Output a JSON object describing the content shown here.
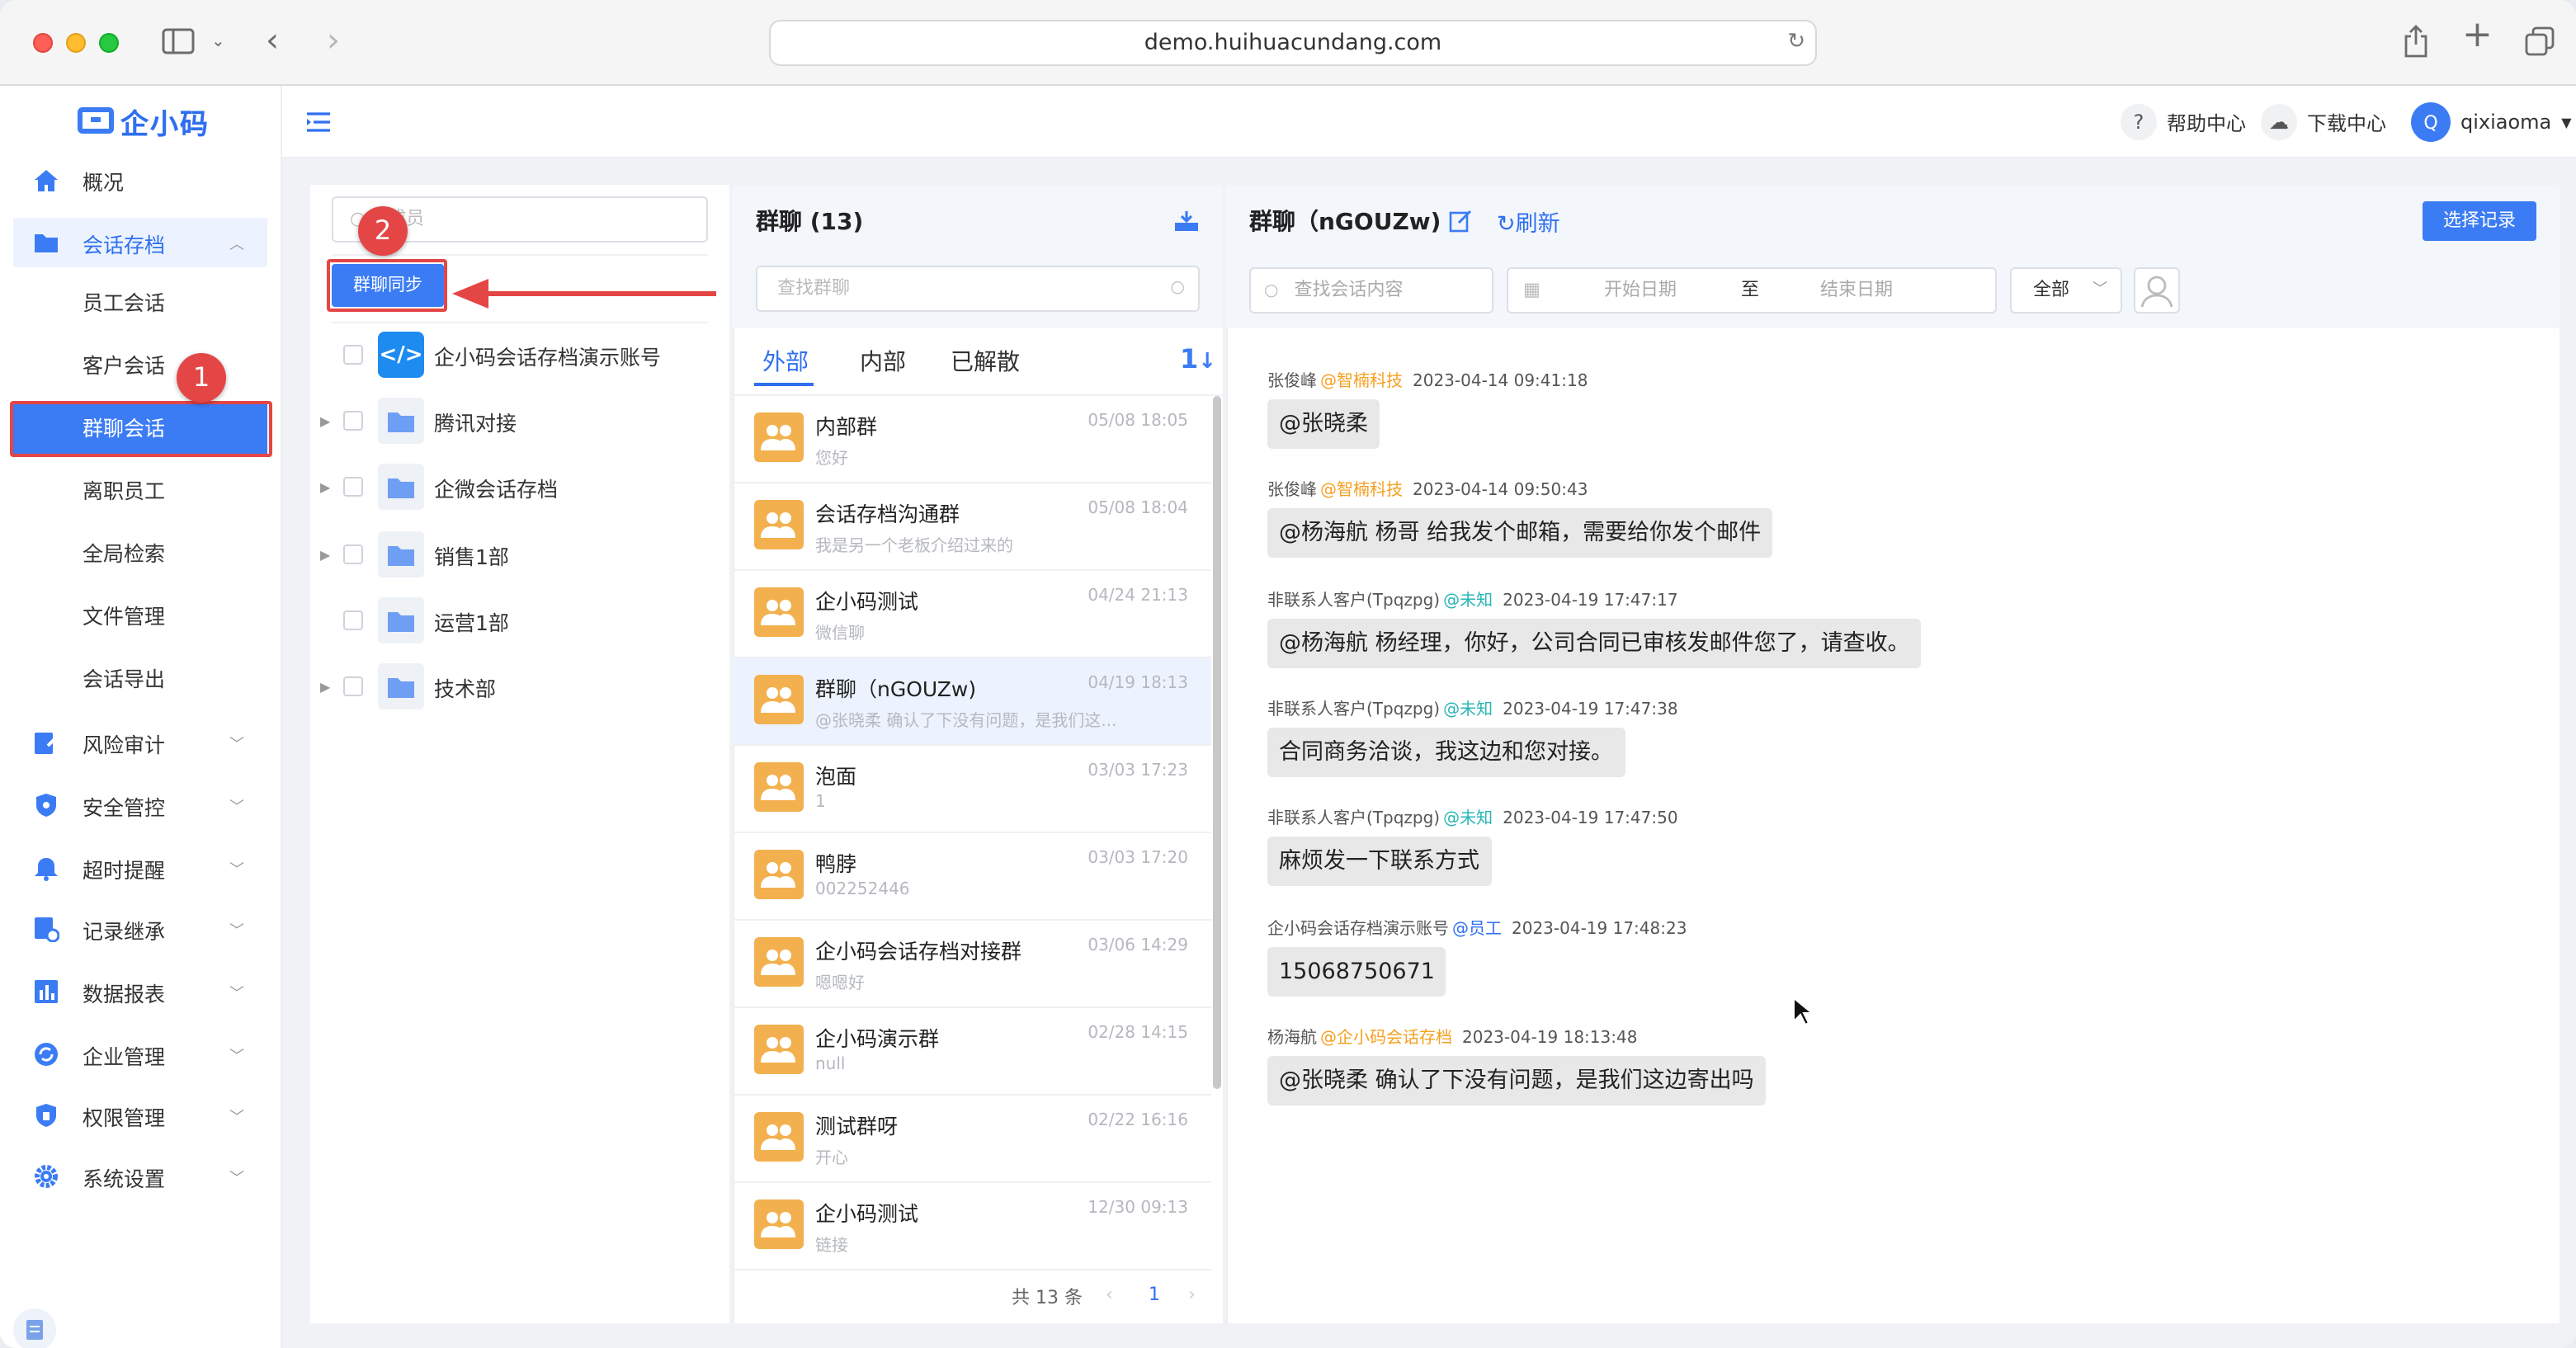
{
  "browser": {
    "url": "demo.huihuacundang.com"
  },
  "brand": {
    "logo_text": "企小码",
    "accent": "#3b7cf5"
  },
  "sidebar": {
    "items": [
      {
        "label": "概况"
      },
      {
        "label": "会话存档"
      },
      {
        "label": "风险审计"
      },
      {
        "label": "安全管控"
      },
      {
        "label": "超时提醒"
      },
      {
        "label": "记录继承"
      },
      {
        "label": "数据报表"
      },
      {
        "label": "企业管理"
      },
      {
        "label": "权限管理"
      },
      {
        "label": "系统设置"
      }
    ],
    "sub_items": [
      {
        "label": "员工会话"
      },
      {
        "label": "客户会话"
      },
      {
        "label": "群聊会话"
      },
      {
        "label": "离职员工"
      },
      {
        "label": "全局检索"
      },
      {
        "label": "文件管理"
      },
      {
        "label": "会话导出"
      }
    ]
  },
  "topbar": {
    "help": "帮助中心",
    "download": "下载中心",
    "avatar_letter": "Q",
    "username": "qixiaoma"
  },
  "annotations": {
    "step1": "1",
    "step2": "2"
  },
  "members": {
    "search_placeholder": "成员",
    "sync_button": "群聊同步",
    "tree": [
      {
        "label": "企小码会话存档演示账号"
      },
      {
        "label": "腾讯对接"
      },
      {
        "label": "企微会话存档"
      },
      {
        "label": "销售1部"
      },
      {
        "label": "运营1部"
      },
      {
        "label": "技术部"
      }
    ]
  },
  "groups": {
    "title": "群聊 (13)",
    "search_placeholder": "查找群聊",
    "tabs": [
      "外部",
      "内部",
      "已解散"
    ],
    "list": [
      {
        "name": "内部群",
        "preview": "您好",
        "time": "05/08 18:05"
      },
      {
        "name": "会话存档沟通群",
        "preview": "我是另一个老板介绍过来的",
        "time": "05/08 18:04"
      },
      {
        "name": "企小码测试",
        "preview": "微信聊",
        "time": "04/24 21:13"
      },
      {
        "name": "群聊（nGOUZw)",
        "preview": "@张晓柔 确认了下没有问题，是我们这...",
        "time": "04/19 18:13"
      },
      {
        "name": "泡面",
        "preview": "1",
        "time": "03/03 17:23"
      },
      {
        "name": "鸭脖",
        "preview": "002252446",
        "time": "03/03 17:20"
      },
      {
        "name": "企小码会话存档对接群",
        "preview": "嗯嗯好",
        "time": "03/06 14:29"
      },
      {
        "name": "企小码演示群",
        "preview": "null",
        "time": "02/28 14:15"
      },
      {
        "name": "测试群呀",
        "preview": "开心",
        "time": "02/22 16:16"
      },
      {
        "name": "企小码测试",
        "preview": "链接",
        "time": "12/30 09:13"
      }
    ],
    "pager": {
      "total": "共 13 条",
      "page": "1"
    }
  },
  "chat": {
    "title": "群聊（nGOUZw)",
    "refresh": "刷新",
    "select_button": "选择记录",
    "search_placeholder": "查找会话内容",
    "start_date": "开始日期",
    "to": "至",
    "end_date": "结束日期",
    "filter": "全部",
    "messages": [
      {
        "sender": "张俊峰",
        "tag": "@智楠科技",
        "tag_color": "#f5a020",
        "time": "2023-04-14 09:41:18",
        "text": "@张晓柔"
      },
      {
        "sender": "张俊峰",
        "tag": "@智楠科技",
        "tag_color": "#f5a020",
        "time": "2023-04-14 09:50:43",
        "text": "@杨海航 杨哥 给我发个邮箱，需要给你发个邮件"
      },
      {
        "sender": "非联系人客户(Tpqzpg)",
        "tag": "@未知",
        "tag_color": "#28b5b5",
        "time": "2023-04-19 17:47:17",
        "text": "@杨海航 杨经理，你好，公司合同已审核发邮件您了，请查收。"
      },
      {
        "sender": "非联系人客户(Tpqzpg)",
        "tag": "@未知",
        "tag_color": "#28b5b5",
        "time": "2023-04-19 17:47:38",
        "text": "合同商务洽谈，我这边和您对接。"
      },
      {
        "sender": "非联系人客户(Tpqzpg)",
        "tag": "@未知",
        "tag_color": "#28b5b5",
        "time": "2023-04-19 17:47:50",
        "text": "麻烦发一下联系方式"
      },
      {
        "sender": "企小码会话存档演示账号",
        "tag": "@员工",
        "tag_color": "#2f6ff0",
        "time": "2023-04-19 17:48:23",
        "text": "15068750671"
      },
      {
        "sender": "杨海航",
        "tag": "@企小码会话存档",
        "tag_color": "#f5a020",
        "time": "2023-04-19 18:13:48",
        "text": "@张晓柔 确认了下没有问题，是我们这边寄出吗"
      }
    ]
  }
}
